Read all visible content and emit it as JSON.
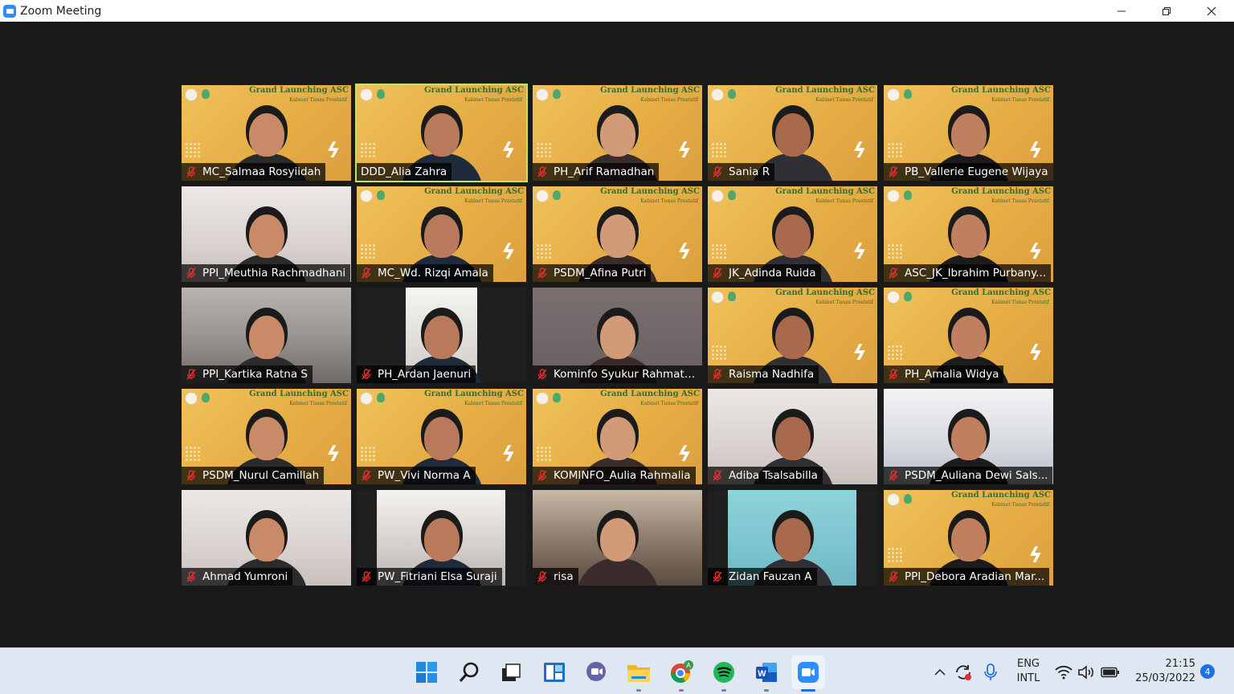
{
  "window": {
    "title": "Zoom Meeting",
    "controls": [
      "minimize-icon",
      "restore-icon",
      "close-icon"
    ]
  },
  "banner": {
    "title": "Grand Launching ASC",
    "subtitle": "Kabinet Tunas Prestatif"
  },
  "colors": {
    "banner_bg": "#e9b54a",
    "active_speaker_border": "#b8e86a",
    "muted_mic": "#e0312e",
    "stage_bg": "#1a1a1a",
    "taskbar_bg": "#dfe7f3",
    "accent": "#1f6fe0"
  },
  "participants": [
    {
      "name": "MC_Salmaa Rosyiidah",
      "muted": true,
      "bg": "banner"
    },
    {
      "name": "DDD_Alia Zahra",
      "muted": false,
      "bg": "banner",
      "active": true
    },
    {
      "name": "PH_Arif Ramadhan",
      "muted": true,
      "bg": "banner"
    },
    {
      "name": "Sania R",
      "muted": true,
      "bg": "banner"
    },
    {
      "name": "PB_Vallerie Eugene Wijaya",
      "muted": true,
      "bg": "banner"
    },
    {
      "name": "PPI_Meuthia Rachmadhani",
      "muted": true,
      "bg": "room"
    },
    {
      "name": "MC_Wd. Rizqi Amala",
      "muted": true,
      "bg": "banner"
    },
    {
      "name": "PSDM_Afina Putri",
      "muted": true,
      "bg": "banner"
    },
    {
      "name": "JK_Adinda Ruida",
      "muted": true,
      "bg": "banner"
    },
    {
      "name": "ASC_JK_Ibrahim Purbany...",
      "muted": true,
      "bg": "banner"
    },
    {
      "name": "PPI_Kartika Ratna S",
      "muted": true,
      "bg": "ceiling"
    },
    {
      "name": "PH_Ardan Jaenuri",
      "muted": true,
      "bg": "portrait"
    },
    {
      "name": "Kominfo Syukur Rahmatu...",
      "muted": true,
      "bg": "dim"
    },
    {
      "name": "Raisma Nadhifa",
      "muted": true,
      "bg": "banner"
    },
    {
      "name": "PH_Amalia Widya",
      "muted": true,
      "bg": "banner"
    },
    {
      "name": "PSDM_Nurul Camillah",
      "muted": true,
      "bg": "banner"
    },
    {
      "name": "PW_Vivi Norma A",
      "muted": true,
      "bg": "banner"
    },
    {
      "name": "KOMINFO_Aulia Rahmalia",
      "muted": true,
      "bg": "banner"
    },
    {
      "name": "Adiba Tsalsabilla",
      "muted": true,
      "bg": "room"
    },
    {
      "name": "PSDM_Auliana Dewi Sals...",
      "muted": true,
      "bg": "office"
    },
    {
      "name": "Ahmad Yumroni",
      "muted": true,
      "bg": "room"
    },
    {
      "name": "PW_Fitriani Elsa Suraji",
      "muted": true,
      "bg": "portrait-light"
    },
    {
      "name": "risa",
      "muted": true,
      "bg": "dorm"
    },
    {
      "name": "Zidan Fauzan A",
      "muted": true,
      "bg": "portrait-blue"
    },
    {
      "name": "PPI_Debora Aradian Mar...",
      "muted": true,
      "bg": "banner"
    }
  ],
  "taskbar": {
    "apps": [
      "windows-start-icon",
      "search-icon",
      "task-view-icon",
      "widgets-icon",
      "teams-chat-icon",
      "file-explorer-icon",
      "chrome-icon",
      "spotify-icon",
      "word-icon",
      "zoom-icon"
    ],
    "language_line1": "ENG",
    "language_line2": "INTL",
    "time": "21:15",
    "date": "25/03/2022",
    "notification_count": "4"
  }
}
